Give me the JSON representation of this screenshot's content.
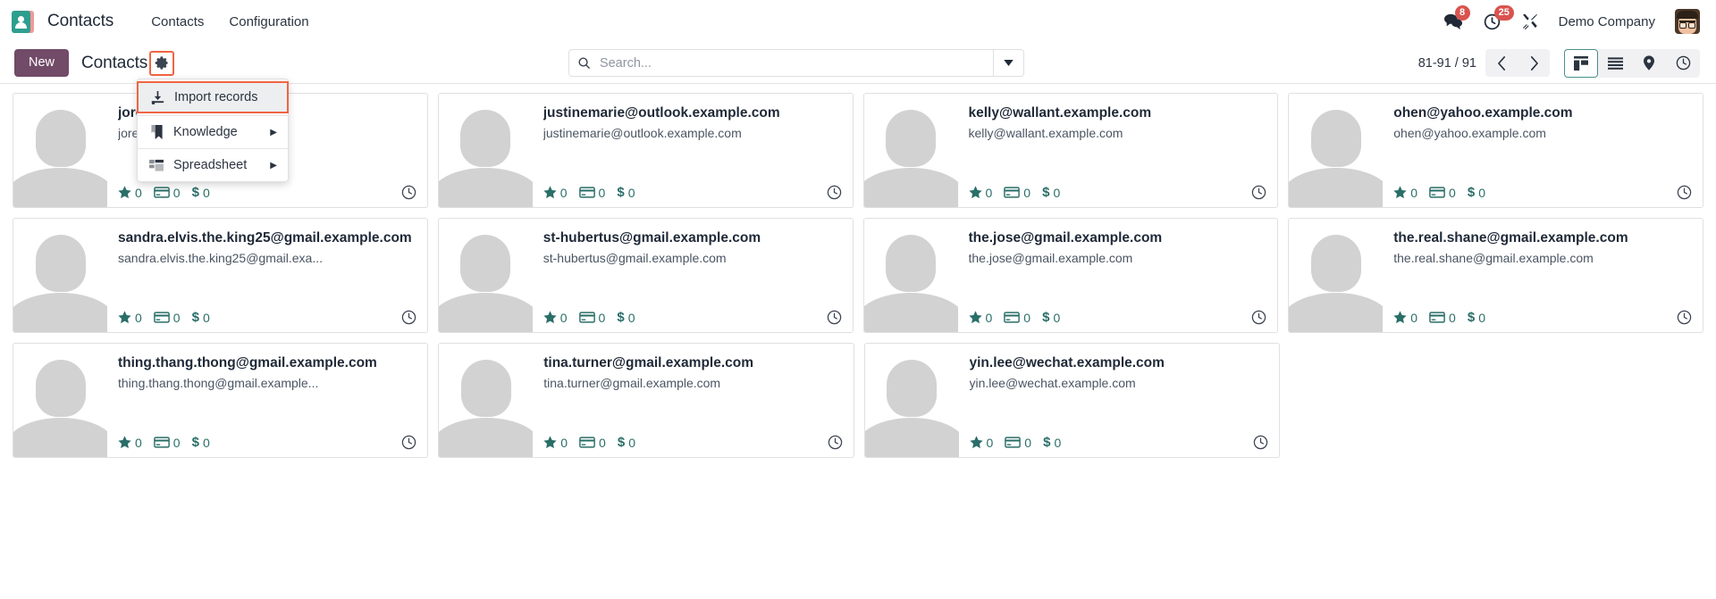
{
  "navbar": {
    "logo_icon": "contacts-app-icon",
    "brand": "Contacts",
    "menus": [
      {
        "label": "Contacts"
      },
      {
        "label": "Configuration"
      }
    ],
    "messages_icon": "chat-bubbles-icon",
    "messages_count": "8",
    "activities_icon": "clock-icon",
    "activities_count": "25",
    "debug_icon": "tools-icon",
    "company": "Demo Company",
    "avatar_icon": "user-avatar"
  },
  "control_panel": {
    "new_label": "New",
    "breadcrumb": "Contacts",
    "gear_icon": "gear-icon",
    "search": {
      "icon": "search-icon",
      "placeholder": "Search...",
      "value": "",
      "toggle_icon": "chevron-down-icon"
    },
    "pager": {
      "count": "81-91 / 91",
      "prev_icon": "chevron-left-icon",
      "next_icon": "chevron-right-icon"
    },
    "views": [
      {
        "name": "kanban",
        "icon": "kanban-icon",
        "active": true
      },
      {
        "name": "list",
        "icon": "list-icon",
        "active": false
      },
      {
        "name": "map",
        "icon": "map-pin-icon",
        "active": false
      },
      {
        "name": "activity",
        "icon": "clock-icon",
        "active": false
      }
    ]
  },
  "dropdown": {
    "open": true,
    "items": [
      {
        "label": "Import records",
        "icon": "download-icon",
        "highlighted": true,
        "has_submenu": false
      },
      {
        "label": "Knowledge",
        "icon": "bookmark-icon",
        "highlighted": false,
        "has_submenu": true
      },
      {
        "label": "Spreadsheet",
        "icon": "spreadsheet-icon",
        "highlighted": false,
        "has_submenu": true
      }
    ],
    "caret_glyph": "▶"
  },
  "colors": {
    "brand_purple": "#714b67",
    "accent_teal": "#2a6e68",
    "highlight_orange": "#f06543",
    "badge_red": "#d9534f"
  },
  "kanban": {
    "stat_icons": {
      "star": "star-icon",
      "card": "credit-card-icon",
      "money": "dollar-icon",
      "activity": "clock-icon"
    },
    "rows": [
      [
        {
          "name": "jore………ple.com",
          "email": "jore…….e.com",
          "stars": "0",
          "invoices": "0",
          "amount": "0"
        },
        {
          "name": "justinemarie@outlook.example.com",
          "email": "justinemarie@outlook.example.com",
          "stars": "0",
          "invoices": "0",
          "amount": "0"
        },
        {
          "name": "kelly@wallant.example.com",
          "email": "kelly@wallant.example.com",
          "stars": "0",
          "invoices": "0",
          "amount": "0"
        },
        {
          "name": "ohen@yahoo.example.com",
          "email": "ohen@yahoo.example.com",
          "stars": "0",
          "invoices": "0",
          "amount": "0"
        }
      ],
      [
        {
          "name": "sandra.elvis.the.king25@gmail.example.com",
          "email": "sandra.elvis.the.king25@gmail.exa...",
          "stars": "0",
          "invoices": "0",
          "amount": "0"
        },
        {
          "name": "st-hubertus@gmail.example.com",
          "email": "st-hubertus@gmail.example.com",
          "stars": "0",
          "invoices": "0",
          "amount": "0"
        },
        {
          "name": "the.jose@gmail.example.com",
          "email": "the.jose@gmail.example.com",
          "stars": "0",
          "invoices": "0",
          "amount": "0"
        },
        {
          "name": "the.real.shane@gmail.example.com",
          "email": "the.real.shane@gmail.example.com",
          "stars": "0",
          "invoices": "0",
          "amount": "0"
        }
      ],
      [
        {
          "name": "thing.thang.thong@gmail.example.com",
          "email": "thing.thang.thong@gmail.example...",
          "stars": "0",
          "invoices": "0",
          "amount": "0"
        },
        {
          "name": "tina.turner@gmail.example.com",
          "email": "tina.turner@gmail.example.com",
          "stars": "0",
          "invoices": "0",
          "amount": "0"
        },
        {
          "name": "yin.lee@wechat.example.com",
          "email": "yin.lee@wechat.example.com",
          "stars": "0",
          "invoices": "0",
          "amount": "0"
        }
      ]
    ]
  }
}
